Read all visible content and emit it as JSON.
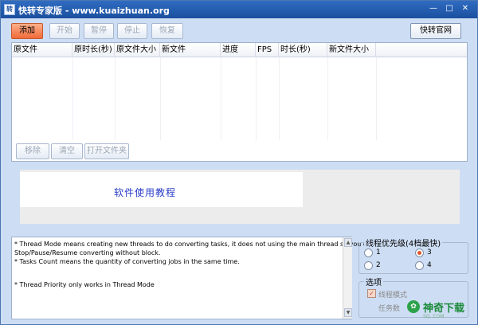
{
  "window": {
    "app_icon_glyph": "转",
    "title": "快转专家版 - www.kuaizhuan.org",
    "min_glyph": "—",
    "max_glyph": "□",
    "close_glyph": "✕"
  },
  "toolbar": {
    "add_label": "添加",
    "start_label": "开始",
    "pause_label": "暂停",
    "stop_label": "停止",
    "restore_label": "恢复",
    "site_label": "快转官网"
  },
  "table": {
    "columns": [
      "原文件",
      "原时长(秒)",
      "原文件大小",
      "新文件",
      "进度",
      "FPS",
      "时长(秒)",
      "新文件大小"
    ]
  },
  "list_actions": {
    "remove_label": "移除",
    "clear_label": "清空",
    "open_folder_label": "打开文件夹"
  },
  "ad": {
    "text": "软件使用教程"
  },
  "notes": {
    "lines": [
      "* Thread Mode means creating new threads to do converting tasks, it does not using the main thread so you can",
      "Stop/Pause/Resume converting without block.",
      "  * Tasks Count means the quantity of converting jobs in the same time.",
      "* Thread Priority only works in Thread Mode"
    ],
    "scroll_up_glyph": "▲",
    "scroll_down_glyph": "▼"
  },
  "priority": {
    "label": "线程优先级(4档最快)",
    "options": [
      "1",
      "2",
      "3",
      "4"
    ],
    "selected": "3"
  },
  "options": {
    "label": "选项",
    "thread_mode_label": "线程模式",
    "thread_mode_checked": true,
    "check_glyph": "✓",
    "tasks_label": "任务数"
  },
  "watermark": {
    "icon_glyph": "✿",
    "text": "神奇下载",
    "sub": "SQ..COM"
  }
}
